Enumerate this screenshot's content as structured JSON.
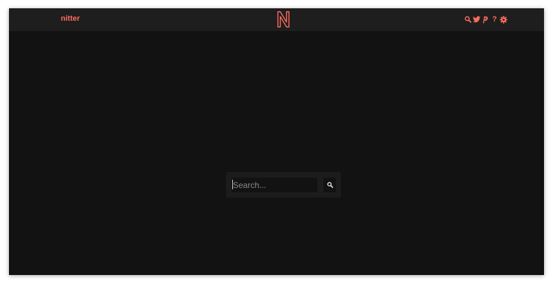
{
  "navbar": {
    "site_name": "nitter",
    "logo_letter": "N",
    "icons": [
      "search-icon",
      "bird-icon",
      "rss-icon",
      "help-icon",
      "gear-icon"
    ],
    "help_glyph": "?"
  },
  "search": {
    "placeholder": "Search...",
    "value": "",
    "button_icon": "search-icon"
  },
  "colors": {
    "accent": "#ff6c60",
    "background": "#121212",
    "navbar": "#1e1e1e",
    "panel": "#1c1c1c",
    "placeholder": "#8a8a8a"
  }
}
